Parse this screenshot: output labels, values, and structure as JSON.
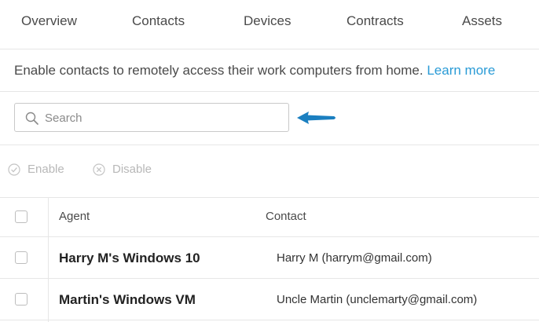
{
  "tabs": [
    {
      "label": "Overview"
    },
    {
      "label": "Contacts"
    },
    {
      "label": "Devices"
    },
    {
      "label": "Contracts"
    },
    {
      "label": "Assets"
    }
  ],
  "info": {
    "text": "Enable contacts to remotely access their work computers from home.",
    "link": "Learn more"
  },
  "search": {
    "placeholder": "Search",
    "icon": "search-icon"
  },
  "actions": {
    "enable": "Enable",
    "disable": "Disable"
  },
  "table": {
    "headers": {
      "agent": "Agent",
      "contact": "Contact"
    },
    "rows": [
      {
        "agent": "Harry M's Windows 10",
        "contact": "Harry M (harrym@gmail.com)"
      },
      {
        "agent": "Martin's Windows VM",
        "contact": "Uncle Martin (unclemarty@gmail.com)"
      }
    ]
  },
  "colors": {
    "accent": "#2a9bd6",
    "arrow": "#1b7fc0",
    "disabled": "#b8b8b8"
  }
}
